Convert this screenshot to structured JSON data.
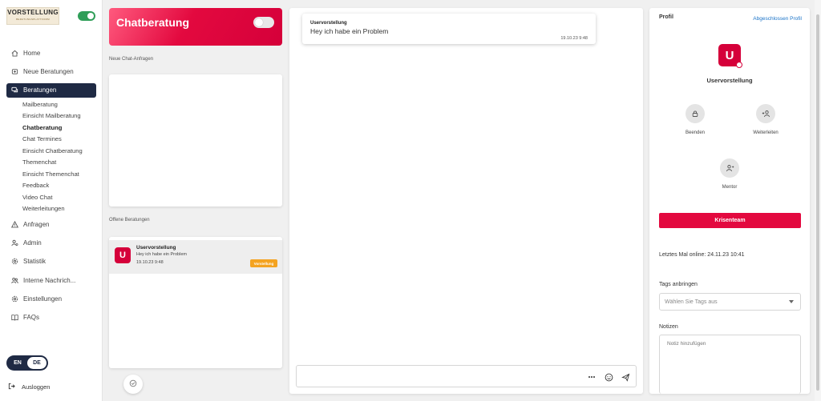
{
  "logo": {
    "text": "VORSTELLUNG",
    "sub": "BERATUNGSPLATTFORM"
  },
  "sidebar": {
    "items": [
      {
        "label": "Home",
        "icon": "home-icon"
      },
      {
        "label": "Neue Beratungen",
        "icon": "new-chat-icon"
      },
      {
        "label": "Beratungen",
        "icon": "chat-bubbles-icon",
        "active": true
      },
      {
        "label": "Anfragen",
        "icon": "warning-icon"
      },
      {
        "label": "Admin",
        "icon": "admin-users-icon"
      },
      {
        "label": "Statistik",
        "icon": "gear-icon"
      },
      {
        "label": "Interne Nachrich...",
        "icon": "people-icon"
      },
      {
        "label": "Einstellungen",
        "icon": "settings-icon"
      },
      {
        "label": "FAQs",
        "icon": "book-icon"
      }
    ],
    "subitems": [
      "Mailberatung",
      "Einsicht Mailberatung",
      "Chatberatung",
      "Chat Termines",
      "Einsicht Chatberatung",
      "Themenchat",
      "Einsicht Themenchat",
      "Feedback",
      "Video Chat",
      "Weiterleitungen"
    ],
    "active_subitem": "Chatberatung",
    "lang": {
      "en": "EN",
      "de": "DE"
    },
    "logout": "Ausloggen"
  },
  "column": {
    "title": "Chatberatung",
    "new_requests_label": "Neue Chat-Anfragen",
    "open_label": "Offene Beratungen",
    "conversation": {
      "avatar": "U",
      "name": "Uservorstellung",
      "message": "Hey ich habe ein Problem",
      "date": "19.10.23 9:48",
      "badge": "Vorstellung"
    }
  },
  "chat": {
    "message": {
      "sender": "Uservorstellung",
      "text": "Hey ich habe ein Problem",
      "time": "19.10.23 9:48"
    },
    "input_value": ""
  },
  "profile": {
    "title": "Profil",
    "link": "Abgeschlossen Profil",
    "avatar": "U",
    "name": "Uservorstellung",
    "actions": {
      "end": "Beenden",
      "forward": "Weiterleiten",
      "mentor": "Mentor"
    },
    "crisis_button": "Krisenteam",
    "last_online": "Letztes Mal online: 24.11.23 10:41",
    "tags_label": "Tags anbringen",
    "tags_placeholder": "Wählen Sie Tags aus",
    "notes_label": "Notizen",
    "notes_placeholder": "Notiz hinzufügen"
  },
  "colors": {
    "brand": "#d5003a",
    "nav_active": "#1f2a44",
    "badge": "#f4a321",
    "toggle_on": "#2f9e58",
    "link": "#1a73c8"
  }
}
